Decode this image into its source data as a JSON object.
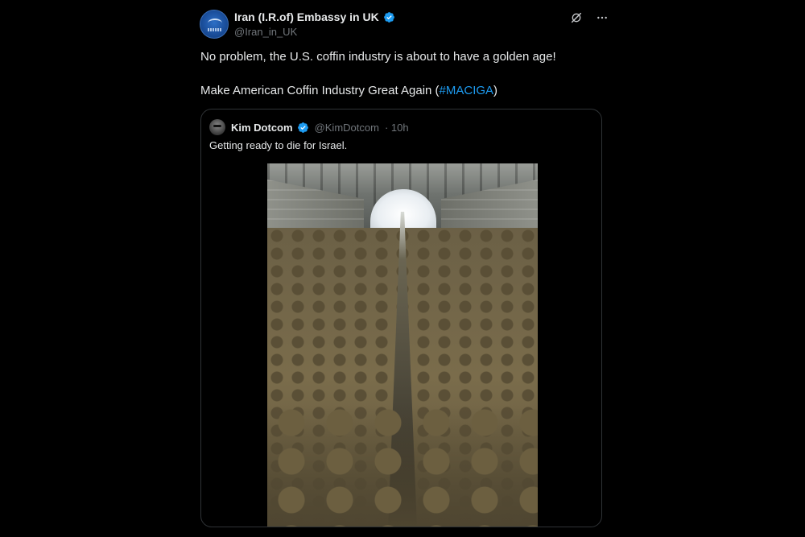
{
  "tweet": {
    "author": {
      "display_name": "Iran (I.R.of) Embassy in UK",
      "handle": "@Iran_in_UK",
      "verified": true
    },
    "line1": "No problem, the U.S. coffin industry is about to have a golden age!",
    "line2_prefix": "Make American Coffin Industry Great Again (",
    "hashtag": "#MACIGA",
    "line2_suffix": ")",
    "colors": {
      "hashtag": "#1d9bf0",
      "verified": "#1d9bf0"
    }
  },
  "top_icons": [
    "grok-icon",
    "more-icon"
  ],
  "quote": {
    "display_name": "Kim Dotcom",
    "handle": "@KimDotcom",
    "time": "· 10h",
    "text": "Getting ready to die for Israel."
  }
}
